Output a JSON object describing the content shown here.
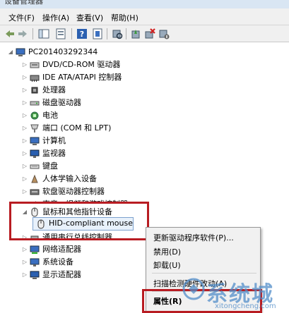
{
  "window": {
    "title": "设备管理器"
  },
  "menu": [
    "文件(F)",
    "操作(A)",
    "查看(V)",
    "帮助(H)"
  ],
  "tree": {
    "root": "PC201403292344",
    "items": [
      "DVD/CD-ROM 驱动器",
      "IDE ATA/ATAPI 控制器",
      "处理器",
      "磁盘驱动器",
      "电池",
      "端口 (COM 和 LPT)",
      "计算机",
      "监视器",
      "键盘",
      "人体学输入设备",
      "软盘驱动器控制器",
      "声音、视频和游戏控制器",
      "鼠标和其他指针设备",
      "HID-compliant mouse",
      "通用串行总线控制器",
      "网络适配器",
      "系统设备",
      "显示适配器"
    ]
  },
  "context_menu": [
    "更新驱动程序软件(P)...",
    "禁用(D)",
    "卸载(U)",
    "扫描检测硬件改动(A)",
    "属性(R)"
  ],
  "watermark": {
    "cn": "系统城",
    "en": "xitongcheng.com"
  },
  "colors": {
    "highlight_box": "#b81c22",
    "selection": "#e8f1fb",
    "watermark": "#508cc8"
  }
}
